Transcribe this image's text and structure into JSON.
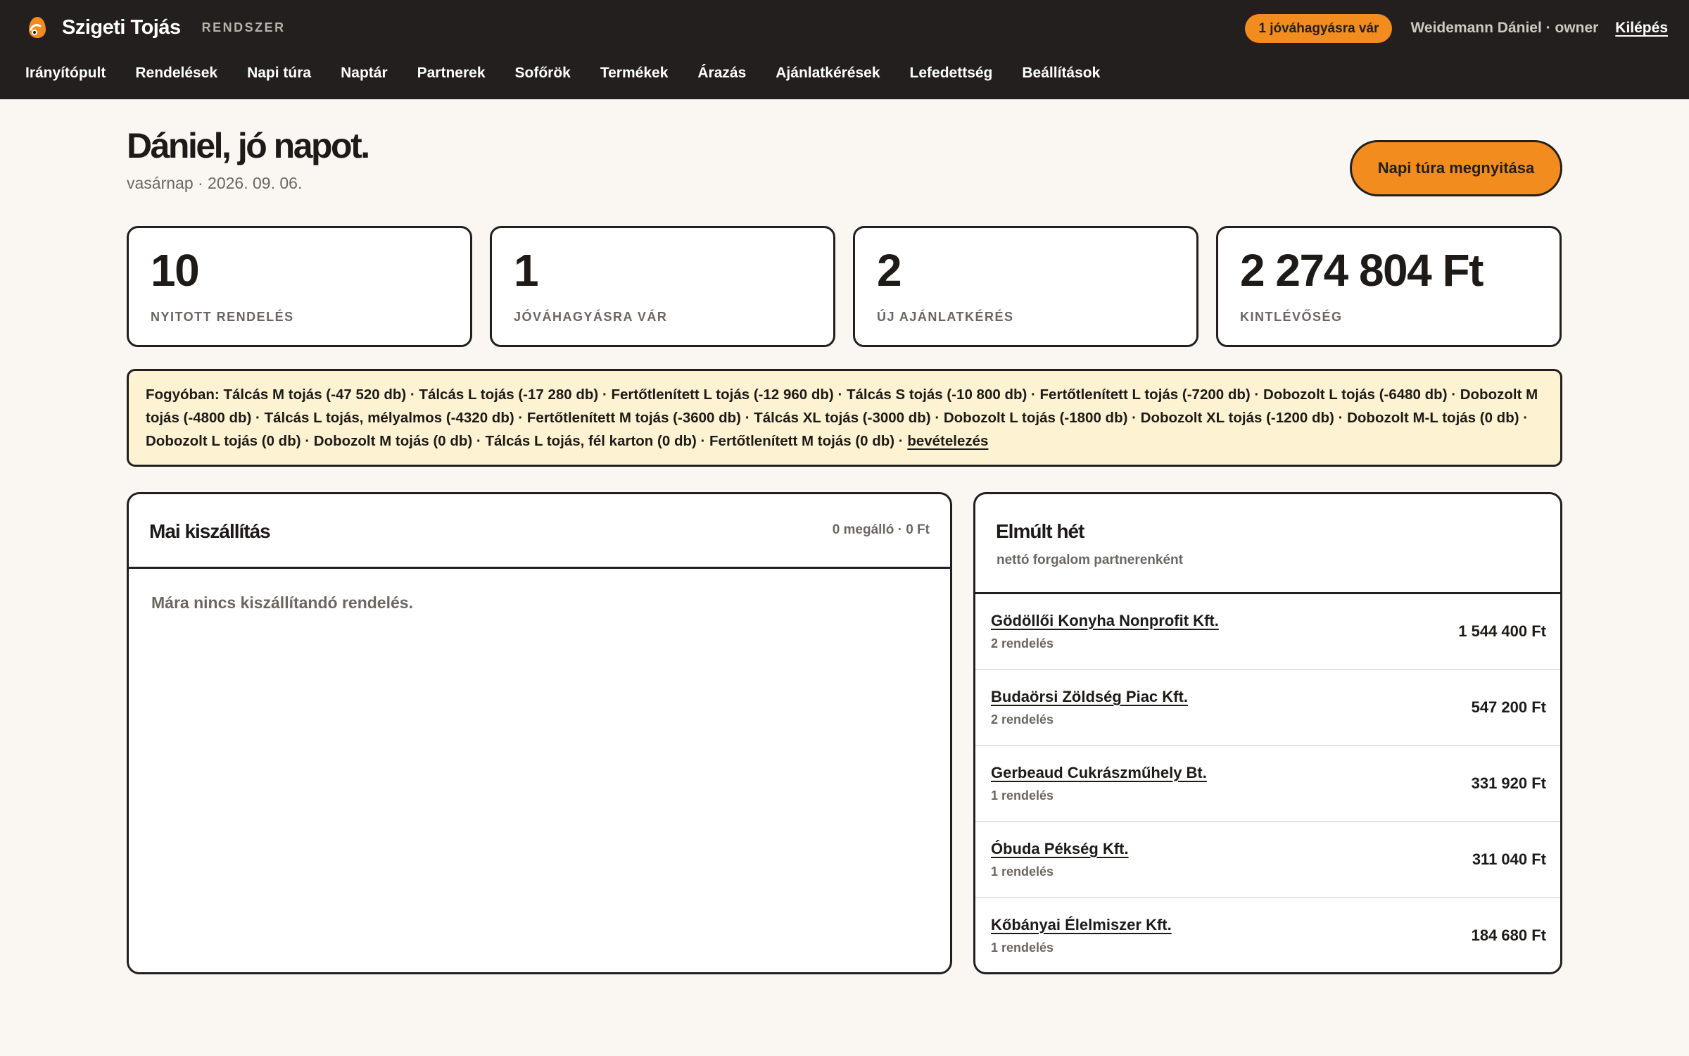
{
  "brand": {
    "name": "Szigeti Tojás",
    "subtitle": "RENDSZER",
    "logo_icon": "egg-logo-icon",
    "accent_color": "#f28c1f"
  },
  "topbar": {
    "pending_badge": "1 jóváhagyásra vár",
    "user": "Weidemann Dániel · owner",
    "logout": "Kilépés"
  },
  "nav": {
    "items": [
      "Irányítópult",
      "Rendelések",
      "Napi túra",
      "Naptár",
      "Partnerek",
      "Sofőrök",
      "Termékek",
      "Árazás",
      "Ajánlatkérések",
      "Lefedettség",
      "Beállítások"
    ]
  },
  "header": {
    "greeting": "Dániel, jó napot.",
    "date": "vasárnap · 2026. 09. 06.",
    "open_tour_button": "Napi túra megnyitása"
  },
  "stats": [
    {
      "value": "10",
      "label": "NYITOTT RENDELÉS"
    },
    {
      "value": "1",
      "label": "JÓVÁHAGYÁSRA VÁR"
    },
    {
      "value": "2",
      "label": "ÚJ AJÁNLATKÉRÉS"
    },
    {
      "value": "2 274 804 Ft",
      "label": "KINTLÉVŐSÉG"
    }
  ],
  "low_stock": {
    "text": "Fogyóban: Tálcás M tojás (-47 520 db) · Tálcás L tojás (-17 280 db) · Fertőtlenített L tojás (-12 960 db) · Tálcás S tojás (-10 800 db) · Fertőtlenített L tojás (-7200 db) · Dobozolt L tojás (-6480 db) · Dobozolt M tojás (-4800 db) · Tálcás L tojás, mélyalmos (-4320 db) · Fertőtlenített M tojás (-3600 db) · Tálcás XL tojás (-3000 db) · Dobozolt L tojás (-1800 db) · Dobozolt XL tojás (-1200 db) · Dobozolt M-L tojás (0 db) · Dobozolt L tojás (0 db) · Dobozolt M tojás (0 db) · Tálcás L tojás, fél karton (0 db) · Fertőtlenített M tojás (0 db) · ",
    "link": "bevételezés",
    "bg_color": "#fdf3d2"
  },
  "today": {
    "title": "Mai kiszállítás",
    "meta": "0 megálló · 0 Ft",
    "empty": "Mára nincs kiszállítandó rendelés."
  },
  "week": {
    "title": "Elmúlt hét",
    "subtitle": "nettó forgalom partnerenként",
    "partners": [
      {
        "name": "Gödöllői Konyha Nonprofit Kft.",
        "count": "2 rendelés",
        "amount": "1 544 400 Ft"
      },
      {
        "name": "Budaörsi Zöldség Piac Kft.",
        "count": "2 rendelés",
        "amount": "547 200 Ft"
      },
      {
        "name": "Gerbeaud Cukrászműhely Bt.",
        "count": "1 rendelés",
        "amount": "331 920 Ft"
      },
      {
        "name": "Óbuda Pékség Kft.",
        "count": "1 rendelés",
        "amount": "311 040 Ft"
      },
      {
        "name": "Kőbányai Élelmiszer Kft.",
        "count": "1 rendelés",
        "amount": "184 680 Ft"
      }
    ]
  }
}
